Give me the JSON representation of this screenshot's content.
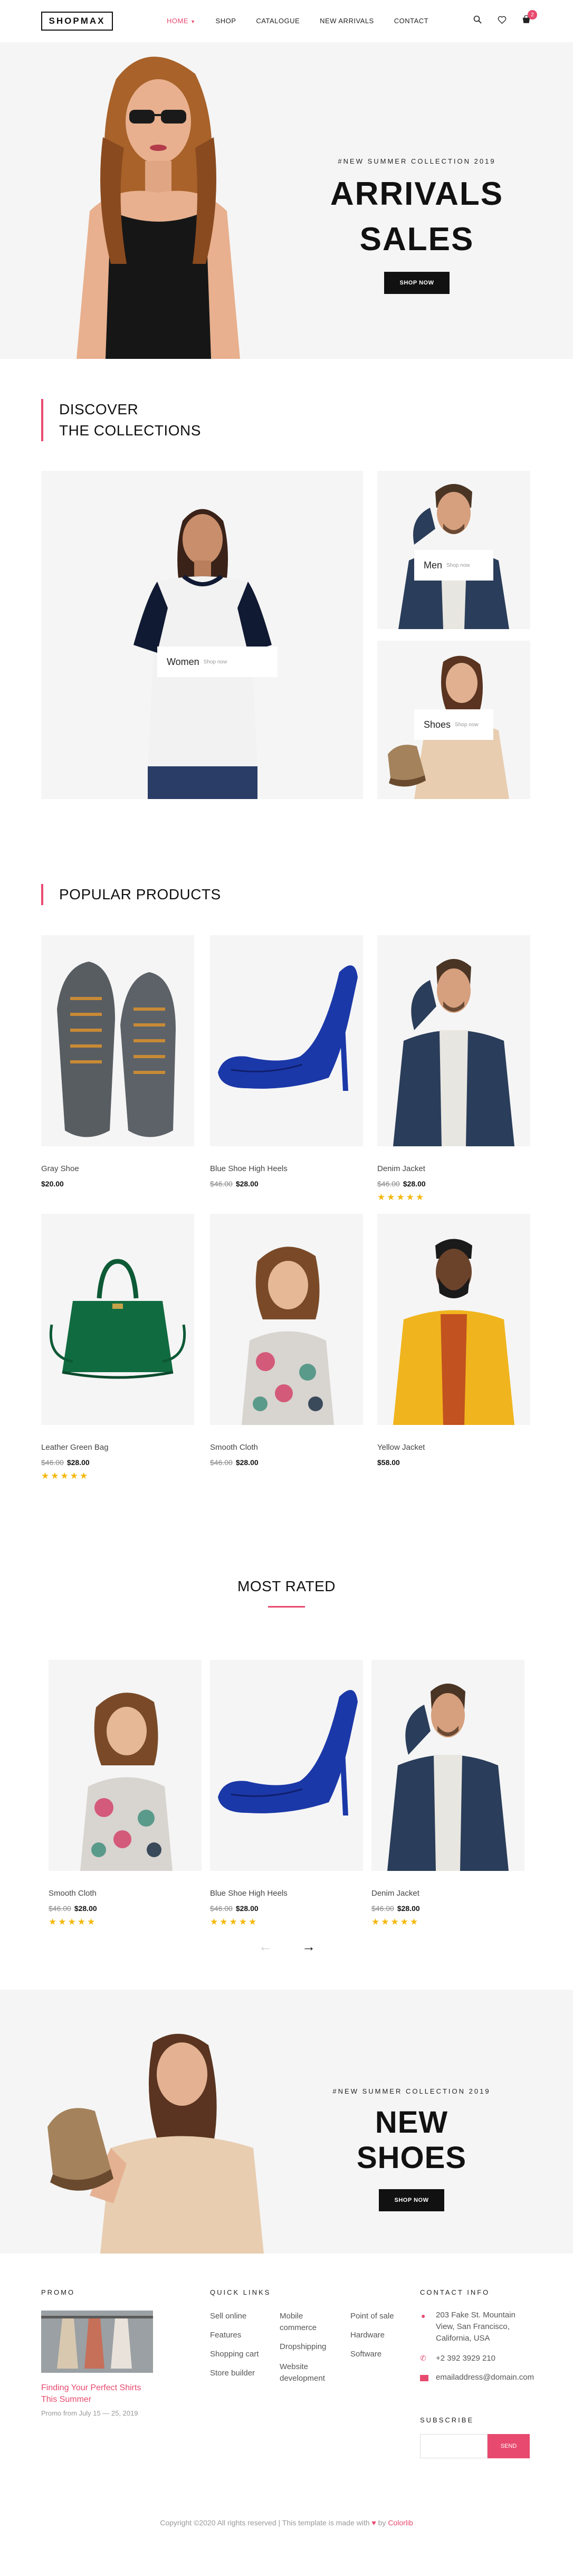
{
  "header": {
    "logo": "SHOPMAX",
    "nav": [
      {
        "label": "HOME",
        "active": true
      },
      {
        "label": "SHOP",
        "active": false
      },
      {
        "label": "CATALOGUE",
        "active": false
      },
      {
        "label": "NEW ARRIVALS",
        "active": false
      },
      {
        "label": "CONTACT",
        "active": false
      }
    ],
    "cart_count": "2",
    "icons": [
      "search-icon",
      "heart-icon",
      "cart-icon"
    ]
  },
  "hero": {
    "subtitle": "#NEW SUMMER COLLECTION 2019",
    "title_line1": "ARRIVALS",
    "title_line2": "SALES",
    "button": "SHOP NOW"
  },
  "collections": {
    "heading_line1": "DISCOVER",
    "heading_line2": "THE COLLECTIONS",
    "items": [
      {
        "label": "Women",
        "sub": "Shop now"
      },
      {
        "label": "Men",
        "sub": "Shop now"
      },
      {
        "label": "Shoes",
        "sub": "Shop now"
      }
    ]
  },
  "popular": {
    "heading": "POPULAR PRODUCTS",
    "products": [
      {
        "name": "Gray Shoe",
        "old_price": "",
        "price": "$20.00",
        "rating": 0
      },
      {
        "name": "Blue Shoe High Heels",
        "old_price": "$46.00",
        "price": "$28.00",
        "rating": 0
      },
      {
        "name": "Denim Jacket",
        "old_price": "$46.00",
        "price": "$28.00",
        "rating": 5
      },
      {
        "name": "Leather Green Bag",
        "old_price": "$46.00",
        "price": "$28.00",
        "rating": 5
      },
      {
        "name": "Smooth Cloth",
        "old_price": "$46.00",
        "price": "$28.00",
        "rating": 0
      },
      {
        "name": "Yellow Jacket",
        "old_price": "",
        "price": "$58.00",
        "rating": 0
      }
    ]
  },
  "most_rated": {
    "heading": "MOST RATED",
    "products": [
      {
        "name": "Smooth Cloth",
        "old_price": "$46.00",
        "price": "$28.00",
        "rating": 5
      },
      {
        "name": "Blue Shoe High Heels",
        "old_price": "$46.00",
        "price": "$28.00",
        "rating": 5
      },
      {
        "name": "Denim Jacket",
        "old_price": "$46.00",
        "price": "$28.00",
        "rating": 5
      }
    ],
    "prev_arrow": "←",
    "next_arrow": "→"
  },
  "banner": {
    "subtitle": "#NEW SUMMER COLLECTION 2019",
    "title": "NEW SHOES",
    "button": "SHOP NOW"
  },
  "footer": {
    "promo_title": "PROMO",
    "promo_link": "Finding Your Perfect Shirts This Summer",
    "promo_date": "Promo from July 15 — 25, 2019",
    "quick_links_title": "QUICK LINKS",
    "links_col1": [
      "Sell online",
      "Features",
      "Shopping cart",
      "Store builder"
    ],
    "links_col2": [
      "Mobile commerce",
      "Dropshipping",
      "Website development"
    ],
    "links_col3": [
      "Point of sale",
      "Hardware",
      "Software"
    ],
    "contact_title": "CONTACT INFO",
    "address": "203 Fake St. Mountain View, San Francisco, California, USA",
    "phone": "+2 392 3929 210",
    "email": "emailaddress@domain.com",
    "subscribe_title": "SUBSCRIBE",
    "subscribe_button": "SEND",
    "copyright": "Copyright ©2020 All rights reserved | This template is made with",
    "copyright_by": "by",
    "copyright_brand": "Colorlib"
  },
  "colors": {
    "accent": "#e84a6f",
    "dark": "#111111",
    "panel": "#f5f5f5",
    "star": "#f5b70a"
  }
}
